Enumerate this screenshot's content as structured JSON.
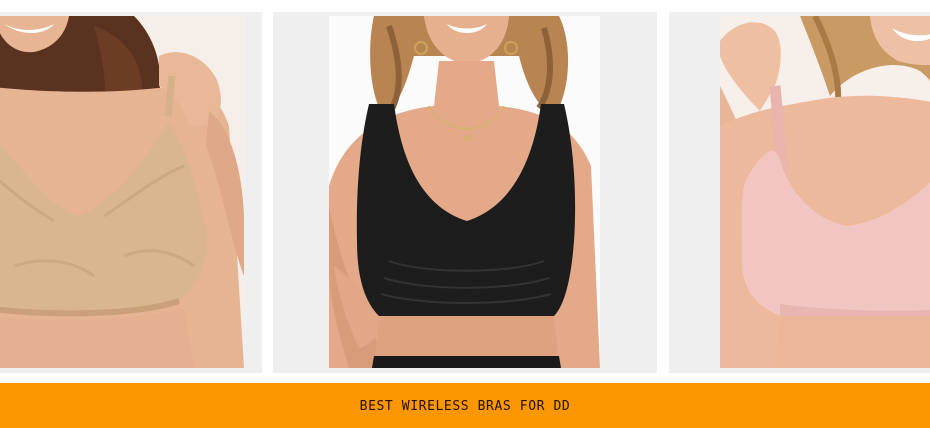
{
  "products": [
    {
      "image_alt": "Beige lace full coverage wireless bra",
      "bra_color": "#d9b690"
    },
    {
      "image_alt": "Black seamless wireless bralette",
      "bra_color": "#1d1d1d"
    },
    {
      "image_alt": "Pink seamless wireless bra",
      "bra_color": "#f1c6c2"
    }
  ],
  "banner": {
    "title": "BEST WIRELESS BRAS FOR DD",
    "color": "#fd9701"
  }
}
